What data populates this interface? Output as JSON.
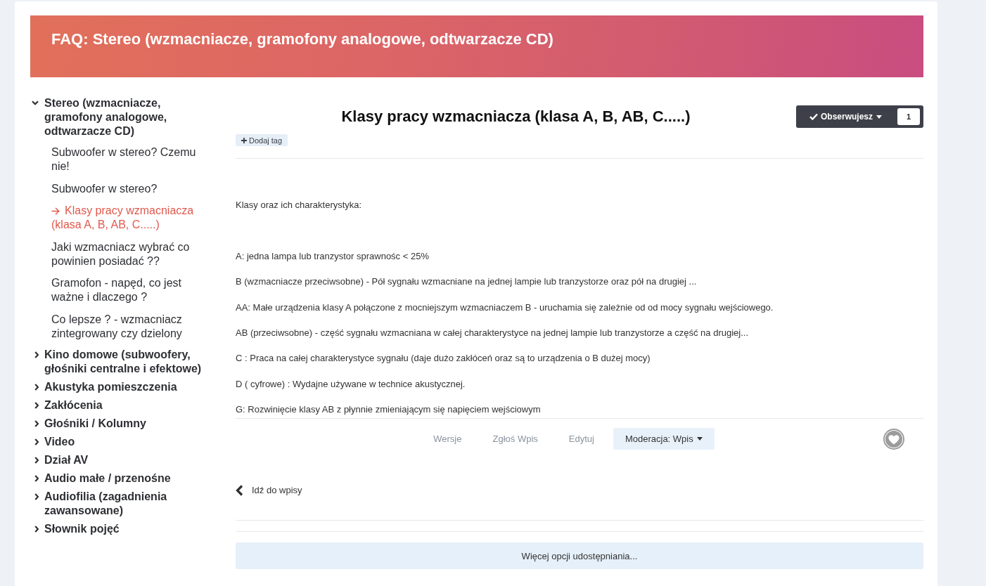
{
  "header": {
    "title": "FAQ: Stereo (wzmacniacze, gramofony analogowe, odtwarzacze CD)"
  },
  "sidebar": {
    "items": [
      {
        "label": "Stereo (wzmacniacze, gramofony analogowe, odtwarzacze CD)",
        "expanded": true,
        "children": [
          {
            "label": "Subwoofer w stereo? Czemu nie!",
            "selected": false
          },
          {
            "label": "Subwoofer w stereo?",
            "selected": false
          },
          {
            "label": "Klasy pracy wzmacniacza (klasa A, B, AB, C.....)",
            "selected": true
          },
          {
            "label": "Jaki wzmacniacz wybrać co powinien posiadać ??",
            "selected": false
          },
          {
            "label": "Gramofon - napęd, co jest ważne i dlaczego ?",
            "selected": false
          },
          {
            "label": "Co lepsze ? - wzmacniacz zintegrowany czy dzielony",
            "selected": false
          }
        ]
      },
      {
        "label": "Kino domowe (subwoofery, głośniki centralne i efektowe)",
        "expanded": false
      },
      {
        "label": "Akustyka pomieszczenia",
        "expanded": false
      },
      {
        "label": "Zakłócenia",
        "expanded": false
      },
      {
        "label": "Głośniki / Kolumny",
        "expanded": false
      },
      {
        "label": "Video",
        "expanded": false
      },
      {
        "label": "Dział AV",
        "expanded": false
      },
      {
        "label": "Audio małe / przenośne",
        "expanded": false
      },
      {
        "label": "Audiofilia (zagadnienia zawansowane)",
        "expanded": false
      },
      {
        "label": "Słownik pojęć",
        "expanded": false
      }
    ]
  },
  "article": {
    "title": "Klasy pracy wzmacniacza (klasa A, B, AB, C.....)",
    "follow": {
      "label": "Obserwujesz",
      "count": "1"
    },
    "tag_button": "Dodaj tag",
    "intro": "Klasy oraz ich charakterystyka:",
    "paragraphs": [
      "A: jedna lampa lub tranzystor sprawnośc < 25%",
      "B (wzmacniacze przeciwsobne) - Pół sygnału wzmacniane na jednej lampie lub tranzystorze oraz pół na drugiej ...",
      "AA: Małe urządzenia klasy A połączone z mocniejszym wzmacniaczem B - uruchamia się zależnie od od mocy sygnału wejściowego.",
      "AB (przeciwsobne) - część sygnału wzmacniana w całej charakterystyce na jednej lampie lub tranzystorze a część na drugiej...",
      "C : Praca na całej charakterystyce sygnału (daje dużo zakłóceń oraz są to urządzenia o B dużej mocy)",
      "D ( cyfrowe) : Wydajne używane w technice akustycznej.",
      "G: Rozwinięcie klasy AB z płynnie zmieniającym się napięciem wejściowym"
    ],
    "actions": [
      {
        "label": "Wersje",
        "kind": "link"
      },
      {
        "label": "Zgłoś Wpis",
        "kind": "link"
      },
      {
        "label": "Edytuj",
        "kind": "link"
      },
      {
        "label": "Moderacja: Wpis",
        "kind": "menu"
      }
    ],
    "liked": false
  },
  "back_link": "Idź do wpisy",
  "share_button": "Więcej opcji udostępniania..."
}
